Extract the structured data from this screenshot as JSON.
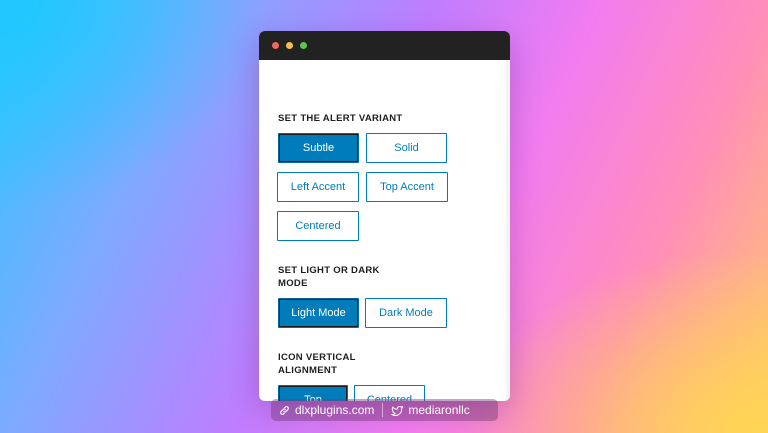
{
  "window": {
    "controls": [
      "close",
      "minimize",
      "maximize"
    ]
  },
  "sections": {
    "alert_variant": {
      "label": "SET THE ALERT VARIANT",
      "options": [
        "Subtle",
        "Solid",
        "Left Accent",
        "Top Accent",
        "Centered"
      ],
      "selected": "Subtle"
    },
    "mode": {
      "label_line1": "SET LIGHT OR DARK",
      "label_line2": "MODE",
      "options": [
        "Light Mode",
        "Dark Mode"
      ],
      "selected": "Light Mode"
    },
    "icon_alignment": {
      "label_line1": "ICON VERTICAL",
      "label_line2": "ALIGNMENT",
      "options": [
        "Top",
        "Centered"
      ],
      "selected": "Top"
    }
  },
  "footer": {
    "website": "dlxplugins.com",
    "twitter": "mediaronllc",
    "website_icon": "link-icon",
    "twitter_icon": "bird-icon"
  },
  "colors": {
    "accent": "#007cba",
    "titlebar": "#222222",
    "window_bg": "#ffffff"
  }
}
